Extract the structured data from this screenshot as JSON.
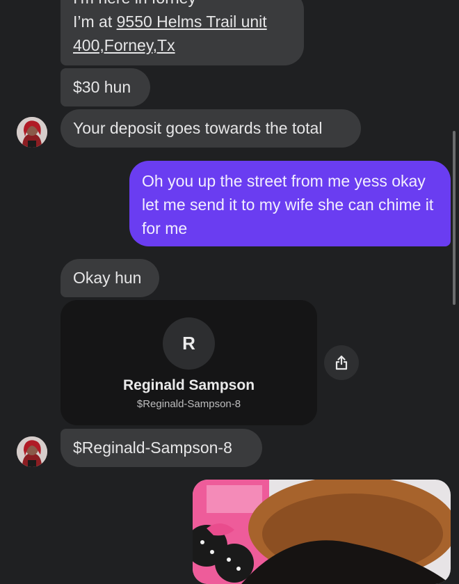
{
  "messages": {
    "address_partial": "I'm here in forney",
    "address_prefix": "I’m at ",
    "address_link_line1": "9550 Helms Trail unit",
    "address_link_line2": "400,Forney,Tx",
    "price": "$30 hun",
    "deposit": "Your deposit goes towards the total",
    "outgoing": "Oh you up the street from me yess okay let me send it to my wife she can chime it for me",
    "okay": "Okay hun",
    "cashtag_message": "$Reginald-Sampson-8"
  },
  "payment_card": {
    "initial": "R",
    "name": "Reginald Sampson",
    "cashtag": "$Reginald-Sampson-8"
  },
  "icons": {
    "share": "share-icon",
    "avatar": "avatar"
  },
  "colors": {
    "background": "#1f2022",
    "incoming_bubble": "#3a3b3d",
    "outgoing_bubble": "#6a3df1",
    "card": "#151516"
  }
}
